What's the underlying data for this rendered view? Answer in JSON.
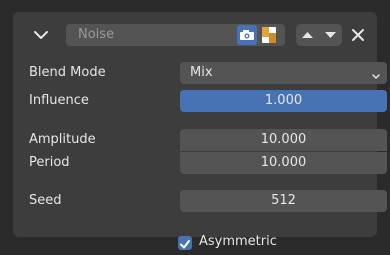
{
  "header": {
    "name_value": "Noise",
    "icons": {
      "collapse": "chevron-down-icon",
      "camera": "camera-icon",
      "render": "render-icon",
      "move_up": "chevron-up-icon",
      "move_down": "chevron-down-icon",
      "close": "close-icon"
    }
  },
  "fields": {
    "blend_mode": {
      "label": "Blend Mode",
      "value": "Mix"
    },
    "influence": {
      "label": "Influence",
      "value": "1.000"
    },
    "amplitude": {
      "label": "Amplitude",
      "value": "10.000"
    },
    "period": {
      "label": "Period",
      "value": "10.000"
    },
    "seed": {
      "label": "Seed",
      "value": "512"
    },
    "asymmetric": {
      "label": "Asymmetric",
      "checked": true
    }
  },
  "colors": {
    "accent": "#4772b3",
    "panel": "#3d3d3d",
    "field": "#545454",
    "background": "#2b2b2b"
  }
}
